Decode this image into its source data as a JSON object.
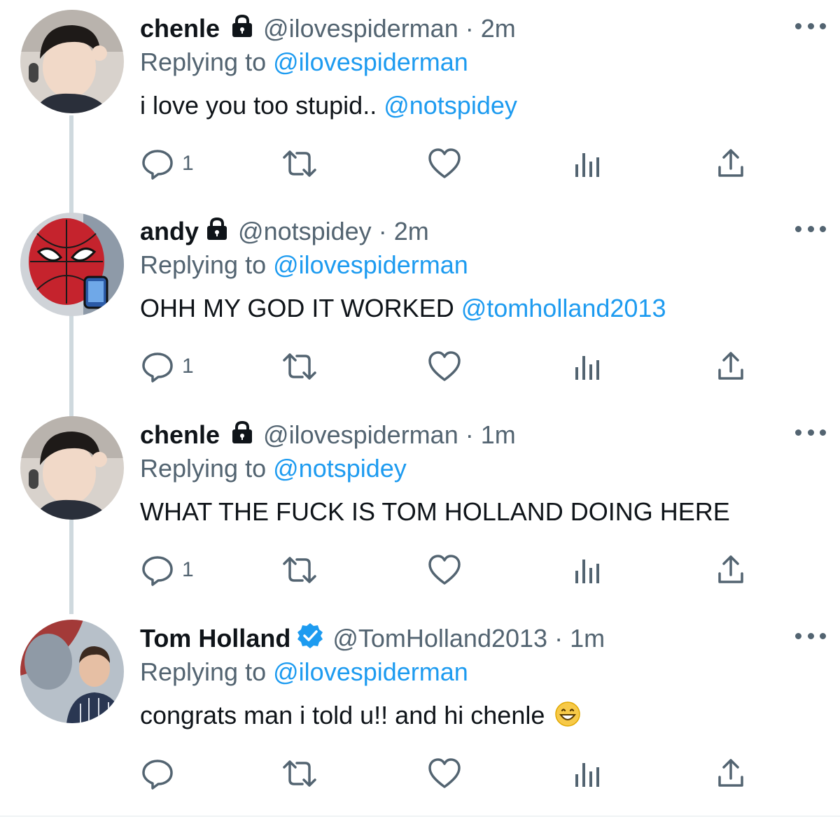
{
  "colors": {
    "accent": "#1d9bf0",
    "muted": "#536471",
    "text": "#0f1419",
    "thread_line": "#cfd9de"
  },
  "tweets": [
    {
      "name": "chenle",
      "lock_icon": "lock-icon",
      "handle": "@ilovespiderman",
      "separator": "·",
      "time": "2m",
      "replying_prefix": "Replying to",
      "replying_to": "@ilovespiderman",
      "text": "i love you too stupid..",
      "text_mention": "@notspidey",
      "reply_count": "1"
    },
    {
      "name": "andy",
      "lock_icon": "lock-icon",
      "handle": "@notspidey",
      "separator": "·",
      "time": "2m",
      "replying_prefix": "Replying to",
      "replying_to": "@ilovespiderman",
      "text": "OHH MY GOD IT WORKED",
      "text_mention": "@tomholland2013",
      "reply_count": "1"
    },
    {
      "name": "chenle",
      "lock_icon": "lock-icon",
      "handle": "@ilovespiderman",
      "separator": "·",
      "time": "1m",
      "replying_prefix": "Replying to",
      "replying_to": "@notspidey",
      "text": "WHAT THE FUCK IS TOM HOLLAND DOING HERE",
      "reply_count": "1"
    },
    {
      "name": "Tom Holland",
      "verified_icon": "verified-badge-icon",
      "handle": "@TomHolland2013",
      "separator": "·",
      "time": "1m",
      "replying_prefix": "Replying to",
      "replying_to": "@ilovespiderman",
      "text": "congrats man i told u!! and hi chenle",
      "emoji": "grinning-face-emoji",
      "reply_count": ""
    }
  ],
  "action_icons": [
    "reply-icon",
    "retweet-icon",
    "like-icon",
    "views-icon",
    "share-icon"
  ],
  "more_icon": "more-options-icon"
}
